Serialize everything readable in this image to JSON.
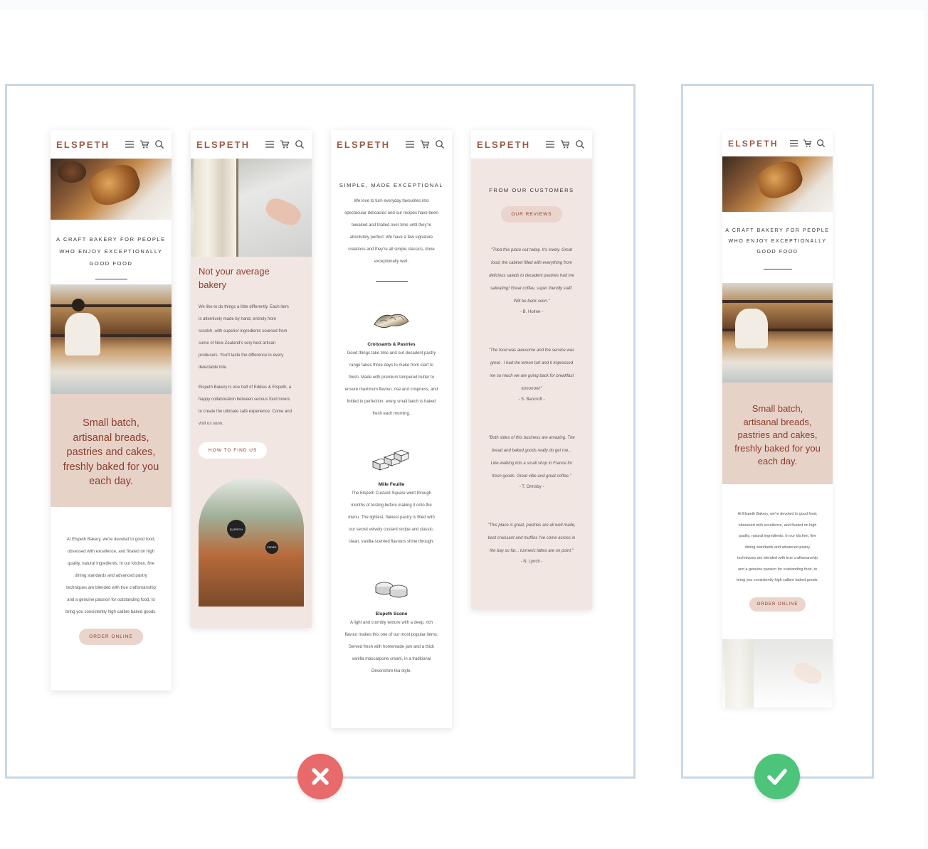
{
  "brand": "ELSPETH",
  "header_icons": [
    "menu-icon",
    "cart-icon",
    "search-icon"
  ],
  "colors": {
    "accent": "#9a5a45",
    "frame": "#c9d8e4",
    "bad": "#e96a6a",
    "good": "#4cc47a",
    "blush": "#f2e6e2",
    "pink": "#e7d2c8"
  },
  "phone1": {
    "tagline": [
      "A CRAFT BAKERY FOR PEOPLE",
      "WHO ENJOY EXCEPTIONALLY",
      "GOOD FOOD"
    ],
    "hero_text": [
      "Small batch,",
      "artisanal breads,",
      "pastries and cakes,",
      "freshly baked for you",
      "each day."
    ],
    "body": [
      "At Elspeth Bakery, we're devoted to good food,",
      "obsessed with excellence, and fixated on high",
      "quality, natural ingredients. In our kitchen, fine",
      "dining standards and advanced pastry",
      "techniques are blended with true craftsmanship",
      "and a genuine passion for outstanding food, to",
      "bring you consistently high calibre baked goods."
    ],
    "button": "ORDER ONLINE"
  },
  "phone2": {
    "heading": [
      "Not your average",
      "bakery"
    ],
    "para1": [
      "We like to do things a little differently. Each item",
      "is attentively made by hand, entirely from",
      "scratch, with superior ingredients sourced from",
      "some of New Zealand's very best artisan",
      "producers. You'll taste the difference in every",
      "delectable bite."
    ],
    "para2": [
      "Elspeth Bakery is one half of Eddies & Elspeth, a",
      "happy collaboration between serious food lovers",
      "to create the ultimate café experience. Come and",
      "visit us soon."
    ],
    "button": "HOW TO FIND US",
    "sign_text": "ELSPETH",
    "sign_text2": "EDDIES"
  },
  "phone3": {
    "heading": "SIMPLE, MADE EXCEPTIONAL",
    "intro": [
      "We love to turn everyday favourites into",
      "spectacular delicacies and our recipes have been",
      "tweaked and trialled over time until they're",
      "absolutely perfect. We have a few signature",
      "creations and they're all simple classics, done",
      "exceptionally well."
    ],
    "products": [
      {
        "title": "Croissants & Pastries",
        "icon": "croissant-icon",
        "lines": [
          "Good things take time and our decadent pastry",
          "range takes three days to make from start to",
          "finish. Made with premium tempered butter to",
          "ensure maximum flavour, rise and crispness, and",
          "folded to perfection, every small batch is baked",
          "fresh each morning."
        ]
      },
      {
        "title": "Mille Feuille",
        "icon": "mille-feuille-icon",
        "lines": [
          "The Elspeth Custard Square went through",
          "months of testing before making it onto the",
          "menu. The lightest, flakiest pastry is filled with",
          "our secret velvety custard recipe and classic,",
          "clean, vanilla-scented flavours shine through."
        ]
      },
      {
        "title": "Elspeth Scone",
        "icon": "scone-icon",
        "lines": [
          "A light and crumbly texture with a deep, rich",
          "flavour makes this one of our most popular items.",
          "Served fresh with homemade jam and a thick",
          "vanilla mascarpone cream, in a traditional",
          "Devonshire tea style."
        ]
      }
    ]
  },
  "phone4": {
    "heading": "FROM OUR CUSTOMERS",
    "button": "OUR REVIEWS",
    "reviews": [
      {
        "lines": [
          "\"Tried this place out today. It's lovely. Great",
          "food, the cabinet filled with everything from",
          "delicious salads to decadent pastries had me",
          "salivating! Great coffee, super friendly staff.",
          "Will be back soon.\""
        ],
        "author": "- B. Holme -"
      },
      {
        "lines": [
          "\"The food was awesome and the service was",
          "great . I had the lemon tart and it impressed",
          "me so much we are going back for breakfast",
          "tomorrow!\""
        ],
        "author": "- S. Bancroft -"
      },
      {
        "lines": [
          "\"Both sides of this business are amazing. The",
          "bread and baked goods really do get me...",
          "Like walking into a small shop in France for",
          "fresh goods. Great vibe and great coffee.\""
        ],
        "author": "- T. Ormsby -"
      },
      {
        "lines": [
          "\"This place is great, pastries are all well made,",
          "best croissant and muffins I've come across in",
          "the bay so far... turmeric lattes are on point.\""
        ],
        "author": "- N. Lynch -"
      }
    ]
  },
  "phone5": {
    "tagline": [
      "A CRAFT BAKERY FOR PEOPLE",
      "WHO ENJOY EXCEPTIONALLY",
      "GOOD FOOD"
    ],
    "hero_text": [
      "Small batch,",
      "artisanal breads,",
      "pastries and cakes,",
      "freshly baked for you",
      "each day."
    ],
    "body": [
      "At Elspeth Bakery, we're devoted to good food,",
      "obsessed with excellence, and fixated on high",
      "quality, natural ingredients. In our kitchen, fine",
      "dining standards and advanced pastry",
      "techniques are blended with true craftsmanship",
      "and a genuine passion for outstanding food, to",
      "bring you consistently high calibre baked goods."
    ],
    "button": "ORDER ONLINE"
  },
  "badges": {
    "bad_icon": "x-mark-icon",
    "good_icon": "check-mark-icon"
  }
}
